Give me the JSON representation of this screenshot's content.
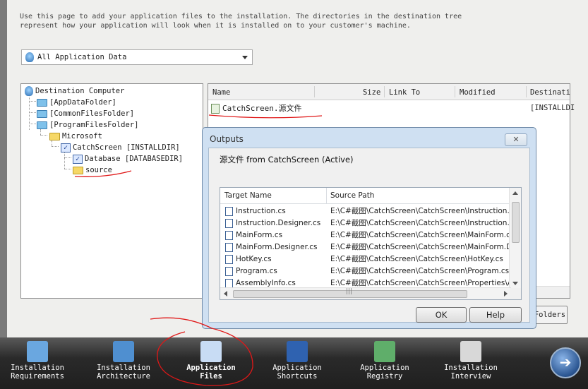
{
  "description_lines": [
    "Use this page to add your application files to the installation. The directories in the destination tree",
    "represent how your application will look when it is installed on to your customer's machine."
  ],
  "filter_combo": {
    "value": "All Application Data"
  },
  "tree": {
    "root": "Destination Computer",
    "nodes": [
      "[AppDataFolder]",
      "[CommonFilesFolder]",
      "[ProgramFilesFolder]",
      "Microsoft",
      "CatchScreen [INSTALLDIR]",
      "Database [DATABASEDIR]",
      "source"
    ]
  },
  "files_list": {
    "columns": [
      "Name",
      "Size",
      "Link To",
      "Modified",
      "Destinati"
    ],
    "row": {
      "name": "CatchScreen.源文件",
      "destination": "[INSTALLDI"
    }
  },
  "folders_button": "Folders",
  "dialog": {
    "title": "Outputs",
    "close": "✕",
    "subtitle": "源文件 from CatchScreen (Active)",
    "columns": [
      "Target Name",
      "Source Path"
    ],
    "rows": [
      {
        "target": "Instruction.cs",
        "source": "E:\\C#截图\\CatchScreen\\CatchScreen\\Instruction.cs"
      },
      {
        "target": "Instruction.Designer.cs",
        "source": "E:\\C#截图\\CatchScreen\\CatchScreen\\Instruction.D"
      },
      {
        "target": "MainForm.cs",
        "source": "E:\\C#截图\\CatchScreen\\CatchScreen\\MainForm.cs"
      },
      {
        "target": "MainForm.Designer.cs",
        "source": "E:\\C#截图\\CatchScreen\\CatchScreen\\MainForm.De"
      },
      {
        "target": "HotKey.cs",
        "source": "E:\\C#截图\\CatchScreen\\CatchScreen\\HotKey.cs"
      },
      {
        "target": "Program.cs",
        "source": "E:\\C#截图\\CatchScreen\\CatchScreen\\Program.cs"
      },
      {
        "target": "AssemblyInfo.cs",
        "source": "E:\\C#截图\\CatchScreen\\CatchScreen\\Properties\\A"
      }
    ],
    "scroll_grip": "|||",
    "ok": "OK",
    "help": "Help"
  },
  "nav": [
    {
      "line1": "Installation",
      "line2": "Requirements",
      "icon": "requirements-icon",
      "color": "#6aa7e0"
    },
    {
      "line1": "Installation",
      "line2": "Architecture",
      "icon": "architecture-icon",
      "color": "#4f8fd0"
    },
    {
      "line1": "Application",
      "line2": "Files",
      "icon": "files-icon",
      "color": "#c8dcf4"
    },
    {
      "line1": "Application",
      "line2": "Shortcuts",
      "icon": "shortcuts-icon",
      "color": "#2f62b0"
    },
    {
      "line1": "Application",
      "line2": "Registry",
      "icon": "registry-icon",
      "color": "#5fae6a"
    },
    {
      "line1": "Installation",
      "line2": "Interview",
      "icon": "interview-icon",
      "color": "#d8d8d8"
    }
  ],
  "annotation_color": "#e01818"
}
